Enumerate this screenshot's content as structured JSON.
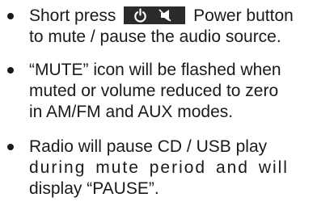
{
  "colors": {
    "text": "#1a1a1a",
    "icon_background": "#2b2b2b",
    "icon_glyph": "#ffffff"
  },
  "icons": {
    "power_button": [
      "power-icon",
      "mute-speaker-icon"
    ]
  },
  "bullets": [
    {
      "lines": [
        {
          "before_icon": "Short press",
          "after_icon": "Power button"
        },
        "to mute / pause the audio source."
      ]
    },
    {
      "lines": [
        "“MUTE” icon will be flashed when",
        "muted or volume reduced to zero",
        "in AM/FM and AUX modes."
      ]
    },
    {
      "lines": [
        "Radio will pause CD / USB play",
        "during mute period and will",
        "display “PAUSE”."
      ]
    }
  ]
}
